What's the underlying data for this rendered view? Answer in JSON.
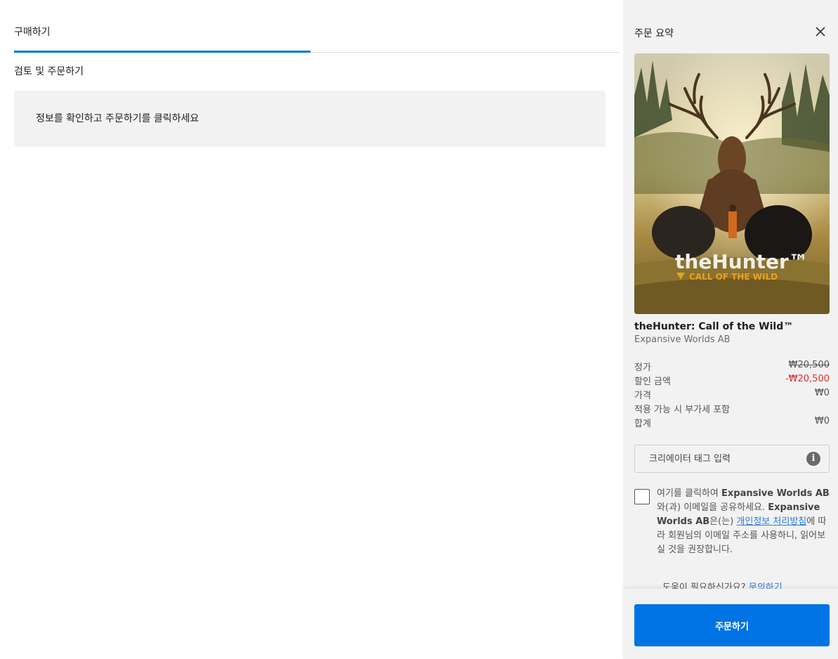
{
  "checkout": {
    "tab_label": "구매하기",
    "section_title": "검토 및 주문하기",
    "info_message": "정보를 확인하고 주문하기를 클릭하세요"
  },
  "summary": {
    "title": "주문 요약",
    "close_icon": "close-icon",
    "product": {
      "cover_logo_main": "theHunter™",
      "cover_logo_sub": "CALL OF THE WILD",
      "name": "theHunter: Call of the Wild™",
      "publisher": "Expansive Worlds AB"
    },
    "prices": {
      "list_label": "정가",
      "list_value": "₩20,500",
      "discount_label": "할인 금액",
      "discount_value": "-₩20,500",
      "price_label": "가격",
      "price_value": "₩0",
      "vat_note": "적용 가능 시 부가세 포함",
      "total_label": "합계",
      "total_value": "₩0"
    },
    "creator_tag": {
      "placeholder": "크리에이터 태그 입력",
      "info_icon": "info-icon"
    },
    "consent": {
      "pre": "여기를 클릭하여 ",
      "publisher": "Expansive Worlds AB",
      "mid": "와(과) 이메일을 공유하세요. ",
      "publisher2": "Expansive Worlds AB",
      "mid2": "은(는) ",
      "link": "개인정보 처리방침",
      "post": "에 따라 회원님의 이메일 주소를 사용하니, 읽어보실 것을 권장합니다."
    },
    "help": {
      "text": "도움이 필요하신가요? ",
      "link": "문의하기"
    },
    "order_button": "주문하기"
  },
  "colors": {
    "accent": "#0074e4",
    "discount": "#e02b2b",
    "panel_bg": "#f2f2f2",
    "link": "#2a7de1"
  }
}
